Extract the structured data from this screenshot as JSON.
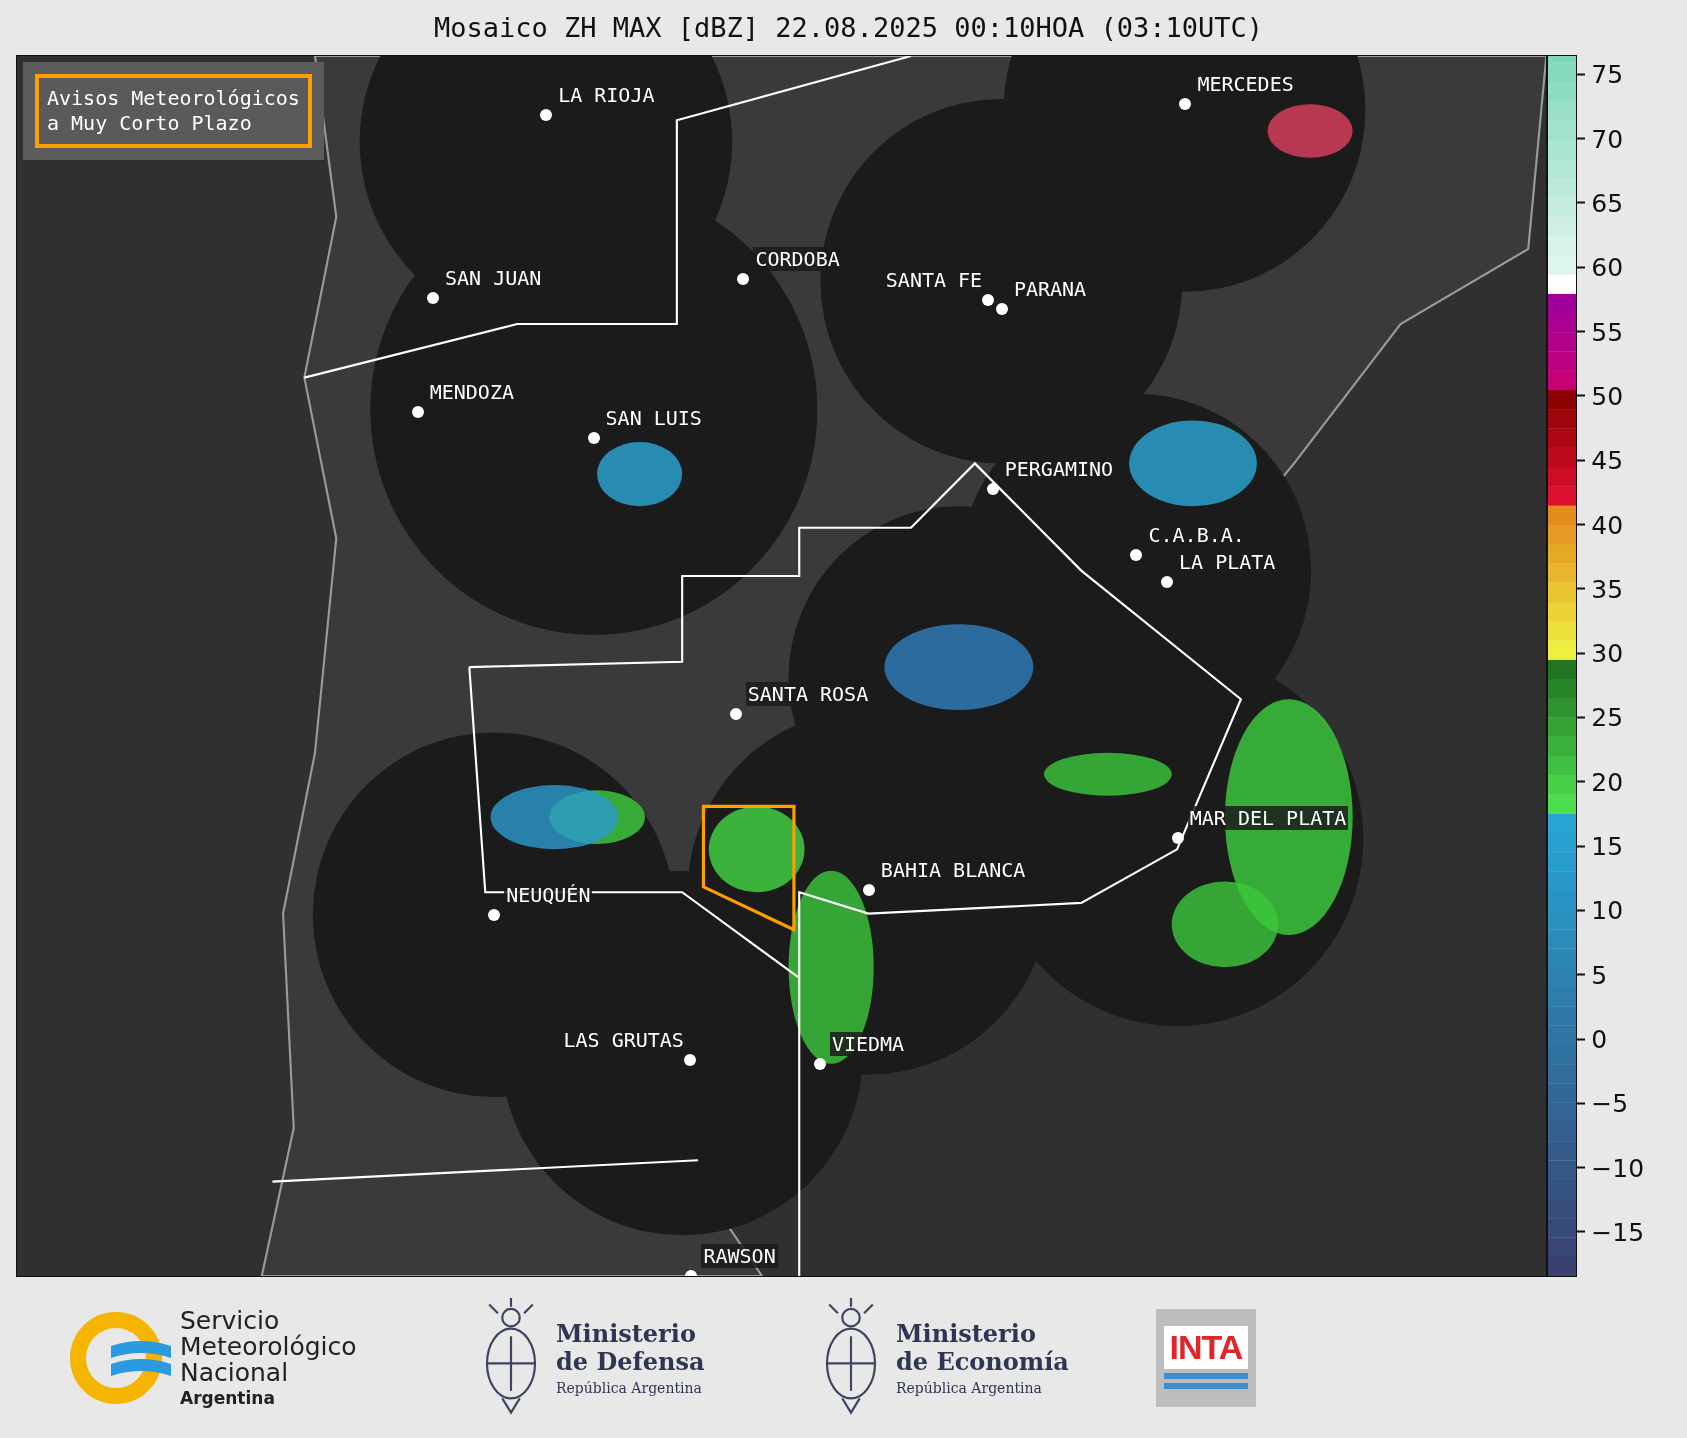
{
  "title": "Mosaico ZH MAX [dBZ] 22.08.2025 00:10HOA (03:10UTC)",
  "warning_box": {
    "lines": [
      "Avisos Meteorológicos",
      "a Muy Corto Plazo"
    ]
  },
  "cities": [
    {
      "name": "LA RIOJA"
    },
    {
      "name": "SAN JUAN"
    },
    {
      "name": "CORDOBA"
    },
    {
      "name": "SANTA FE"
    },
    {
      "name": "PARANA"
    },
    {
      "name": "MERCEDES"
    },
    {
      "name": "MENDOZA"
    },
    {
      "name": "SAN LUIS"
    },
    {
      "name": "PERGAMINO"
    },
    {
      "name": "C.A.B.A."
    },
    {
      "name": "LA PLATA"
    },
    {
      "name": "SANTA ROSA"
    },
    {
      "name": "MAR DEL PLATA"
    },
    {
      "name": "BAHIA BLANCA"
    },
    {
      "name": "NEUQUÉN"
    },
    {
      "name": "LAS GRUTAS"
    },
    {
      "name": "VIEDMA"
    },
    {
      "name": "RAWSON"
    }
  ],
  "colorbar": {
    "ticks": [
      "75",
      "70",
      "65",
      "60",
      "55",
      "50",
      "45",
      "40",
      "35",
      "30",
      "25",
      "20",
      "15",
      "10",
      "5",
      "0",
      "−5",
      "−10",
      "−15"
    ]
  },
  "footer": {
    "logos": [
      {
        "kind": "smn",
        "lines": [
          "Servicio",
          "Meteorológico",
          "Nacional"
        ],
        "subtitle": "Argentina"
      },
      {
        "kind": "ministry",
        "lines": [
          "Ministerio",
          "de Defensa"
        ],
        "subtitle": "República Argentina"
      },
      {
        "kind": "ministry",
        "lines": [
          "Ministerio",
          "de Economía"
        ],
        "subtitle": "República Argentina"
      },
      {
        "kind": "inta",
        "lines": [
          "INTA"
        ]
      }
    ]
  }
}
